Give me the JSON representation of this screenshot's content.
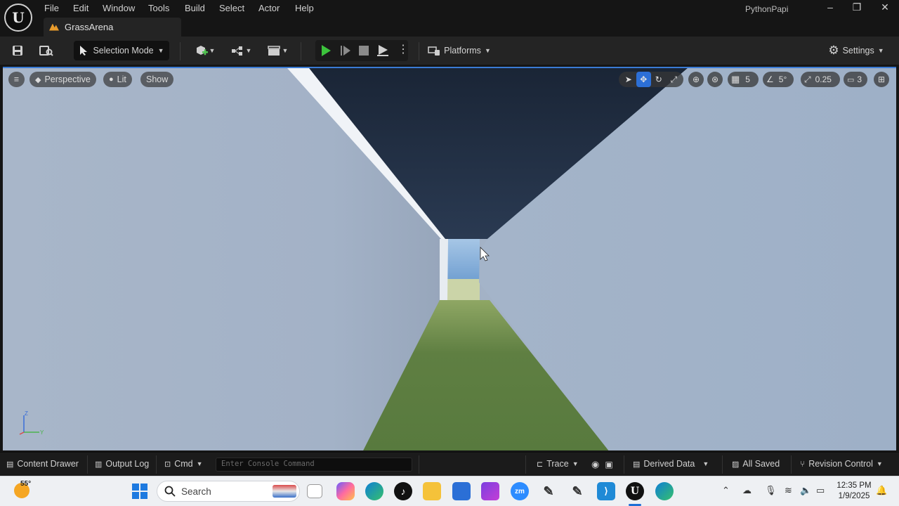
{
  "menubar": {
    "items": [
      "File",
      "Edit",
      "Window",
      "Tools",
      "Build",
      "Select",
      "Actor",
      "Help"
    ],
    "project_name": "PythonPapi",
    "level_tab": "GrassArena"
  },
  "toolbar": {
    "selection_mode": "Selection Mode",
    "platforms": "Platforms",
    "settings": "Settings"
  },
  "viewport": {
    "menu_label": "≡",
    "perspective": "Perspective",
    "lit": "Lit",
    "show": "Show",
    "grid_snap": "5",
    "rotation_snap": "5°",
    "scale_snap": "0.25",
    "camera_speed": "3",
    "axis_labels": {
      "z": "Z",
      "y": "Y"
    }
  },
  "statusbar": {
    "content_drawer": "Content Drawer",
    "output_log": "Output Log",
    "cmd": "Cmd",
    "console_placeholder": "Enter Console Command",
    "trace": "Trace",
    "derived_data": "Derived Data",
    "all_saved": "All Saved",
    "revision_control": "Revision Control"
  },
  "taskbar": {
    "weather_temp": "55°",
    "search_label": "Search",
    "time": "12:35 PM",
    "date": "1/9/2025"
  },
  "colors": {
    "accent": "#2c6fd6",
    "play_green": "#3cc33c",
    "wall": "#a9b8cb",
    "sky": "#1d2a3d",
    "grass": "#5c7a3e"
  }
}
